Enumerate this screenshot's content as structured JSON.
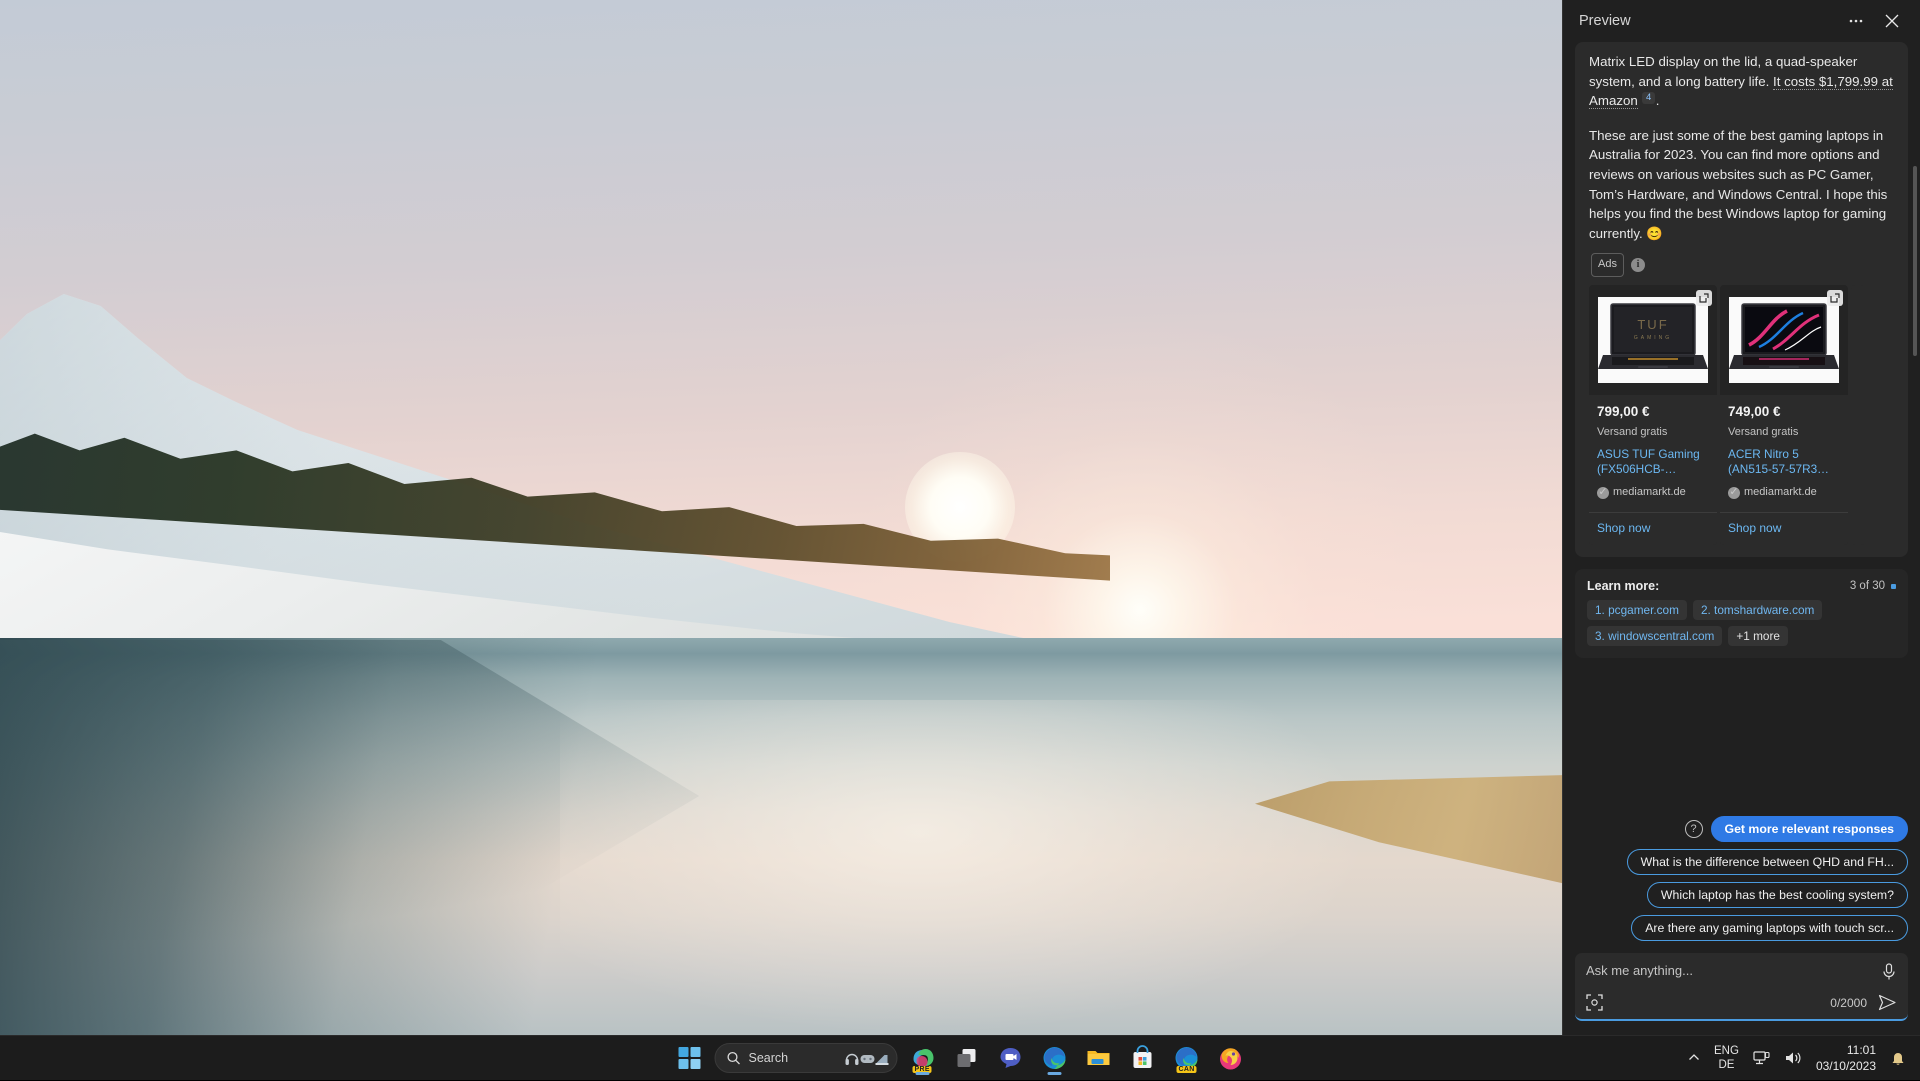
{
  "desktop": {
    "wallpaper_name": "windows-11-sunset-lake-wallpaper"
  },
  "panel": {
    "title": "Preview",
    "more_options_label": "⋯",
    "close_label": "✕",
    "message": {
      "paragraph1_a": "Matrix LED display on the lid, a quad-speaker system, and a long battery life.",
      "paragraph1_b": "It costs $1,799.99 at Amazon",
      "citation_number": "4",
      "paragraph1_c": ".",
      "paragraph2": "These are just some of the best gaming laptops in Australia for 2023. You can find more options and reviews on various websites such as PC Gamer, Tom’s Hardware, and Windows Central. I hope this helps you find the best Windows laptop for gaming currently.",
      "emoji": "😊"
    },
    "ads": {
      "label": "Ads",
      "info_label": "i",
      "cards": [
        {
          "price": "799,00 €",
          "shipping": "Versand gratis",
          "title": "ASUS TUF Gaming (FX506HCB-…",
          "seller": "mediamarkt.de",
          "cta": "Shop now",
          "screen_art": "tuf-gaming-orange"
        },
        {
          "price": "749,00 €",
          "shipping": "Versand gratis",
          "title": "ACER Nitro 5 (AN515-57-57R3…",
          "seller": "mediamarkt.de",
          "cta": "Shop now",
          "screen_art": "nitro-pink-blue"
        }
      ]
    },
    "learn_more": {
      "label": "Learn more:",
      "count": "3 of 30",
      "sources": [
        "1. pcgamer.com",
        "2. tomshardware.com",
        "3. windowscentral.com"
      ],
      "more_label": "+1 more"
    },
    "suggestions": {
      "primary": "Get more relevant responses",
      "items": [
        "What is the difference between QHD and FH...",
        "Which laptop has the best cooling system?",
        "Are there any gaming laptops with touch scr..."
      ]
    },
    "composer": {
      "placeholder": "Ask me anything...",
      "char_count": "0/2000"
    },
    "colors": {
      "accent": "#4a9be0",
      "primary_button": "#2f7ae5",
      "link": "#6cb8f2",
      "panel_bg": "#202020",
      "card_bg": "#2b2b2b"
    }
  },
  "taskbar": {
    "search_placeholder": "Search",
    "apps": [
      {
        "name": "start",
        "label": "Start"
      },
      {
        "name": "copilot-preview",
        "label": "Copilot (PRE)",
        "badge": "PRE",
        "running": true
      },
      {
        "name": "task-view",
        "label": "Task View"
      },
      {
        "name": "teams-chat",
        "label": "Chat"
      },
      {
        "name": "microsoft-edge",
        "label": "Microsoft Edge",
        "running": true
      },
      {
        "name": "file-explorer",
        "label": "File Explorer"
      },
      {
        "name": "microsoft-store",
        "label": "Microsoft Store"
      },
      {
        "name": "edge-canary",
        "label": "Edge Canary",
        "badge": "CAN"
      },
      {
        "name": "firefox",
        "label": "Firefox"
      }
    ],
    "tray": {
      "chevron": "⌃",
      "language_line1": "ENG",
      "language_line2": "DE",
      "time": "11:01",
      "date": "03/10/2023"
    }
  }
}
